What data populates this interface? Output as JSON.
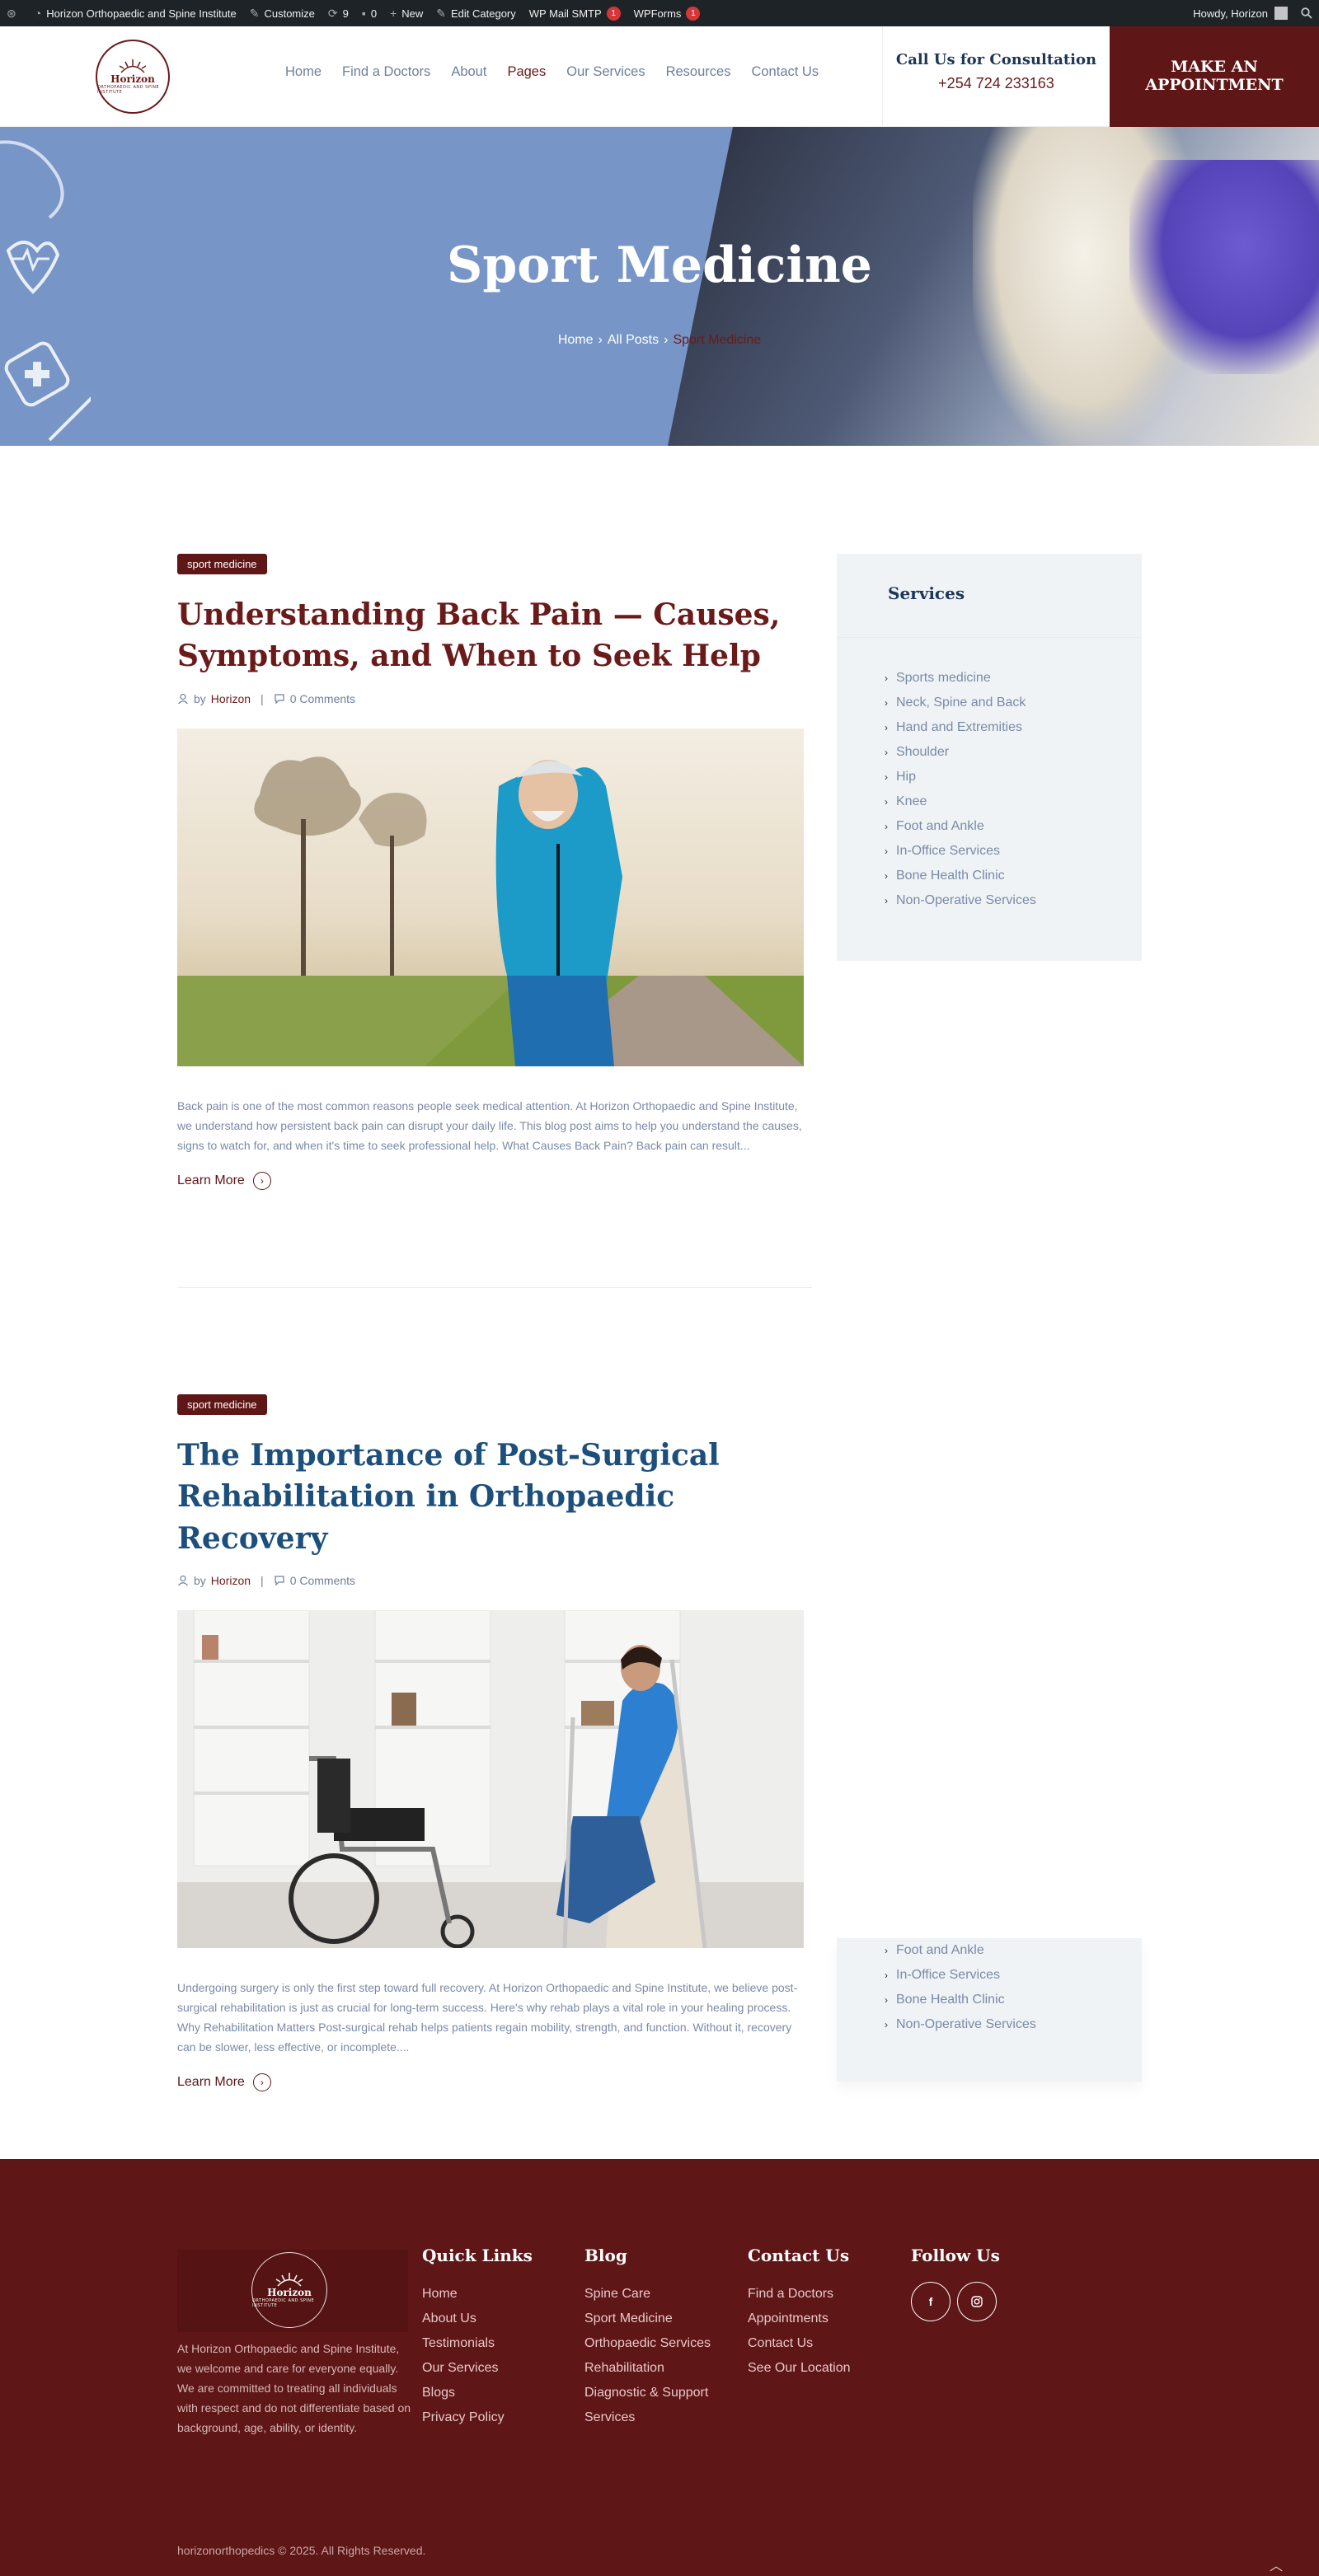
{
  "admin_bar": {
    "site_name": "Horizon Orthopaedic and Spine Institute",
    "customize": "Customize",
    "updates_count": "9",
    "comments_count": "0",
    "new_label": "New",
    "edit_category": "Edit Category",
    "wp_mail_smtp": "WP Mail SMTP",
    "wp_mail_smtp_badge": "1",
    "wpforms": "WPForms",
    "wpforms_badge": "1",
    "howdy": "Howdy, Horizon"
  },
  "header": {
    "logo_text": "Horizon",
    "logo_subtext": "ORTHOPAEDIC AND SPINE INSTITUTE",
    "nav": [
      "Home",
      "Find a Doctors",
      "About",
      "Pages",
      "Our Services",
      "Resources",
      "Contact Us"
    ],
    "nav_active": "Pages",
    "call_title": "Call Us for Consultation",
    "call_phone": "+254 724 233163",
    "appointment_line1": "MAKE AN",
    "appointment_line2": "APPOINTMENT"
  },
  "hero": {
    "title": "Sport Medicine",
    "breadcrumb": [
      "Home",
      "All Posts",
      "Sport Medicine"
    ]
  },
  "posts": [
    {
      "category": "sport medicine",
      "title_line1": "Understanding Back Pain — Causes,",
      "title_line2": "Symptoms, and When to Seek Help",
      "title_color": "#6b1a1a",
      "by": "by",
      "author": "Horizon",
      "comments": "0 Comments",
      "excerpt": "Back pain is one of the most common reasons people seek medical attention. At Horizon Orthopaedic and Spine Institute, we understand how persistent back pain can disrupt your daily life. This blog post aims to help you understand the causes, signs to watch for, and when it's time to seek professional help. What Causes Back Pain? Back pain can result...",
      "learn_more": "Learn More"
    },
    {
      "category": "sport medicine",
      "title_line1": "The Importance of Post-Surgical",
      "title_line2": "Rehabilitation in Orthopaedic Recovery",
      "title_color": "#1d4f7c",
      "by": "by",
      "author": "Horizon",
      "comments": "0 Comments",
      "excerpt": "Undergoing surgery is only the first step toward full recovery. At Horizon Orthopaedic and Spine Institute, we believe post-surgical rehabilitation is just as crucial for long-term success. Here's why rehab plays a vital role in your healing process. Why Rehabilitation Matters Post-surgical rehab helps patients regain mobility, strength, and function. Without it, recovery can be slower, less effective, or incomplete....",
      "learn_more": "Learn More"
    }
  ],
  "sidebar": {
    "title": "Services",
    "items": [
      "Sports medicine",
      "Neck, Spine and Back",
      "Hand and Extremities",
      "Shoulder",
      "Hip",
      "Knee",
      "Foot and Ankle",
      "In-Office Services",
      "Bone Health Clinic",
      "Non-Operative Services"
    ],
    "sticky_items": [
      "Foot and Ankle",
      "In-Office Services",
      "Bone Health Clinic",
      "Non-Operative Services"
    ]
  },
  "footer": {
    "logo_text": "Horizon",
    "logo_subtext": "ORTHOPAEDIC AND SPINE INSTITUTE",
    "about": "At Horizon Orthopaedic and Spine Institute, we welcome and care for everyone equally. We are committed to treating all individuals with respect and do not differentiate based on background, age, ability, or identity.",
    "quick_links_title": "Quick Links",
    "quick_links": [
      "Home",
      "About Us",
      "Testimonials",
      "Our Services",
      "Blogs",
      "Privacy Policy"
    ],
    "blog_title": "Blog",
    "blog_links": [
      "Spine Care",
      "Sport Medicine",
      "Orthopaedic Services",
      "Rehabilitation",
      "Diagnostic & Support",
      "Services"
    ],
    "contact_title": "Contact Us",
    "contact_links": [
      "Find a Doctors",
      "Appointments",
      "Contact Us",
      "See Our Location"
    ],
    "follow_title": "Follow Us",
    "social": [
      "f",
      "ig"
    ],
    "copyright": "horizonorthopedics © 2025. All Rights Reserved."
  }
}
